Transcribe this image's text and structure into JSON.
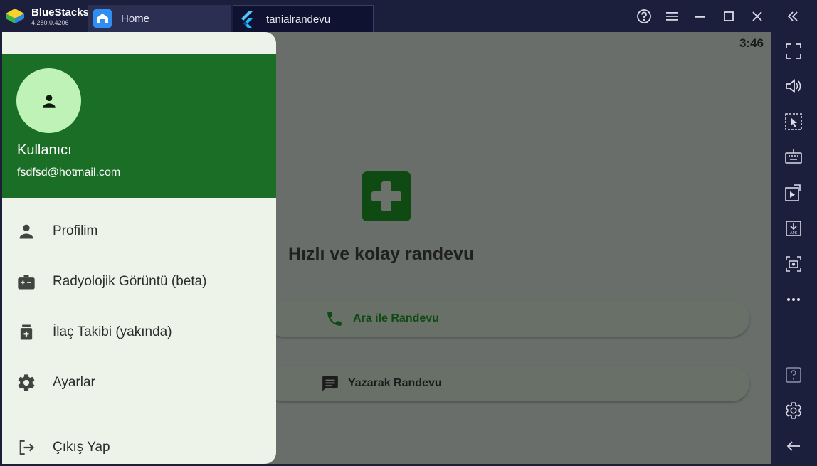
{
  "titlebar": {
    "app_name": "BlueStacks",
    "version": "4.280.0.4206",
    "tabs": [
      {
        "label": "Home",
        "icon": "home-icon"
      },
      {
        "label": "tanialrandevu",
        "icon": "flutter-icon"
      }
    ],
    "controls": [
      "help-icon",
      "menu-icon",
      "minimize-icon",
      "maximize-icon",
      "close-icon",
      "collapse-sidebar-icon"
    ]
  },
  "device": {
    "clock": "3:46",
    "headline": "Hızlı ve kolay randevu",
    "buttons": {
      "call": "Ara ile Randevu",
      "write": "Yazarak Randevu"
    }
  },
  "drawer": {
    "user_name": "Kullanıcı",
    "user_email": "fsdfsd@hotmail.com",
    "items": [
      {
        "label": "Profilim",
        "icon": "person-icon"
      },
      {
        "label": "Radyolojik Görüntü (beta)",
        "icon": "medical-badge-icon"
      },
      {
        "label": "İlaç Takibi (yakında)",
        "icon": "medication-icon"
      },
      {
        "label": "Ayarlar",
        "icon": "settings-icon"
      },
      {
        "label": "Çıkış Yap",
        "icon": "logout-icon"
      }
    ]
  },
  "sidebar": {
    "buttons": [
      "fullscreen-icon",
      "volume-icon",
      "pointer-select-icon",
      "keyboard-icon",
      "media-import-icon",
      "apk-install-icon",
      "screenshot-icon",
      "more-icon",
      "help-icon",
      "settings-icon",
      "back-icon"
    ]
  },
  "colors": {
    "frame": "#1b1f3b",
    "drawer_header": "#1b6e25",
    "drawer_bg": "#eef3ea",
    "avatar": "#bff2b7",
    "accent_green": "#0f4a13"
  }
}
